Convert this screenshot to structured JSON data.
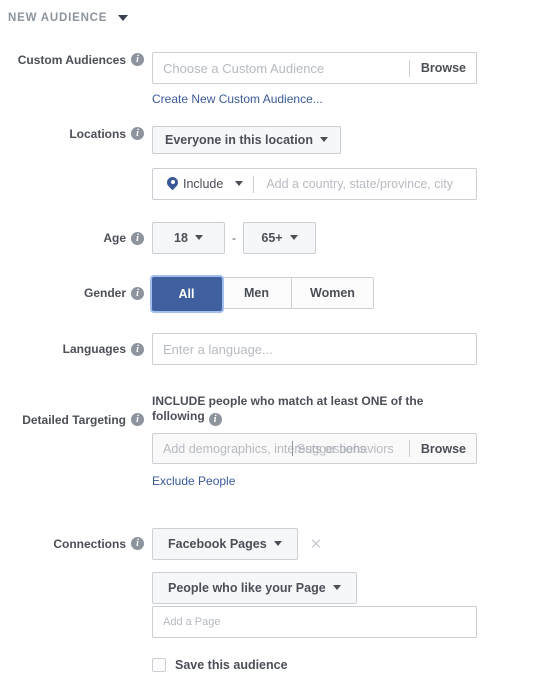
{
  "header": {
    "title": "NEW AUDIENCE",
    "caret_icon": "chevron-down-icon"
  },
  "rows": {
    "custom_audiences": {
      "label": "Custom Audiences",
      "placeholder": "Choose a Custom Audience",
      "browse_label": "Browse",
      "create_link": "Create New Custom Audience..."
    },
    "locations": {
      "label": "Locations",
      "scope_button": "Everyone in this location",
      "include_label": "Include",
      "pin_icon": "location-pin-icon",
      "placeholder": "Add a country, state/province, city"
    },
    "age": {
      "label": "Age",
      "min": "18",
      "max": "65+",
      "separator": "-"
    },
    "gender": {
      "label": "Gender",
      "options": [
        {
          "label": "All",
          "selected": true
        },
        {
          "label": "Men",
          "selected": false
        },
        {
          "label": "Women",
          "selected": false
        }
      ]
    },
    "languages": {
      "label": "Languages",
      "placeholder": "Enter a language..."
    },
    "detailed_targeting": {
      "label": "Detailed Targeting",
      "heading": "INCLUDE people who match at least ONE of the following",
      "placeholder": "Add demographics, interests or behaviors",
      "overlay_text": "Suggestions",
      "browse_label": "Browse",
      "exclude_link": "Exclude People"
    },
    "connections": {
      "label": "Connections",
      "type_button": "Facebook Pages",
      "remove_icon": "close-icon",
      "relation_button": "People who like your Page",
      "page_placeholder": "Add a Page"
    },
    "save_audience": {
      "label": "Save this audience",
      "checked": false
    }
  },
  "colors": {
    "accent_blue": "#3b5998",
    "selected_blue": "#3f5f9f",
    "label_gray": "#4b4f56",
    "border_gray": "#ccd0d5",
    "placeholder_gray": "#b6bbc1"
  }
}
